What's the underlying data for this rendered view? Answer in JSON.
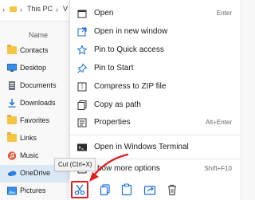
{
  "colors": {
    "accent": "#1a6fd4",
    "highlight_red": "#e02020",
    "folder": "#f4c443",
    "selected_bg": "#dbe8f6"
  },
  "address_bar": {
    "items": [
      "This PC",
      "V"
    ]
  },
  "navigation": {
    "column_header": "Name",
    "items": [
      {
        "label": "Contacts",
        "icon": "folder-icon"
      },
      {
        "label": "Desktop",
        "icon": "desktop-icon"
      },
      {
        "label": "Documents",
        "icon": "documents-icon"
      },
      {
        "label": "Downloads",
        "icon": "downloads-icon"
      },
      {
        "label": "Favorites",
        "icon": "favorites-icon"
      },
      {
        "label": "Links",
        "icon": "folder-icon"
      },
      {
        "label": "Music",
        "icon": "music-icon"
      },
      {
        "label": "OneDrive",
        "icon": "onedrive-icon",
        "selected": true
      },
      {
        "label": "Pictures",
        "icon": "pictures-icon"
      }
    ]
  },
  "context_menu": {
    "items": [
      {
        "label": "Open",
        "shortcut": "Enter",
        "icon": "open-icon"
      },
      {
        "label": "Open in new window",
        "shortcut": "",
        "icon": "new-window-icon"
      },
      {
        "label": "Pin to Quick access",
        "shortcut": "",
        "icon": "pin-icon"
      },
      {
        "label": "Pin to Start",
        "shortcut": "",
        "icon": "pin-start-icon"
      },
      {
        "label": "Compress to ZIP file",
        "shortcut": "",
        "icon": "zip-icon"
      },
      {
        "label": "Copy as path",
        "shortcut": "",
        "icon": "copy-path-icon"
      },
      {
        "label": "Properties",
        "shortcut": "Alt+Enter",
        "icon": "properties-icon"
      },
      {
        "label": "Open in Windows Terminal",
        "shortcut": "",
        "icon": "terminal-icon"
      },
      {
        "label": "how more options",
        "shortcut": "Shift+F10",
        "icon": "more-options-icon"
      }
    ],
    "toolbar": [
      "cut-icon",
      "copy-icon",
      "paste-icon",
      "share-icon",
      "delete-icon"
    ]
  },
  "tooltip": {
    "text": "Cut (Ctrl+X)"
  }
}
